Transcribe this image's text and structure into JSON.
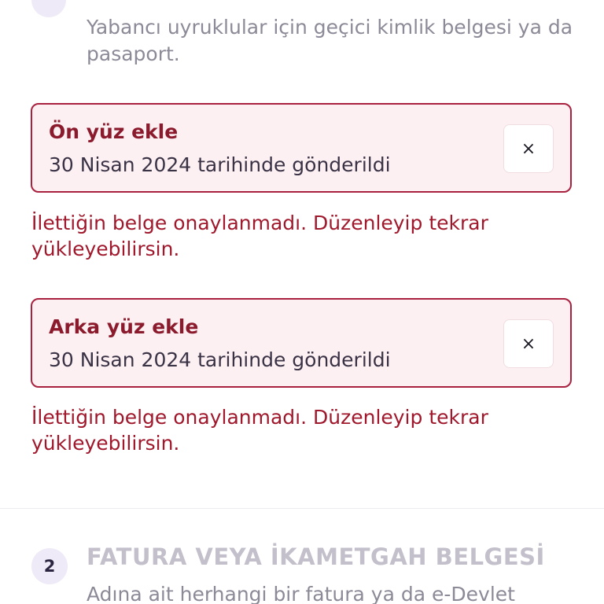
{
  "intro": {
    "text": "Yabancı uyruklular için geçici kimlik belgesi ya da pasaport."
  },
  "cards": [
    {
      "title": "Ön yüz ekle",
      "subtitle": "30 Nisan 2024 tarihinde gönderildi",
      "remove_icon": "×",
      "error": "İlettiğin belge onaylanmadı. Düzenleyip tekrar yükleyebilirsin."
    },
    {
      "title": "Arka yüz ekle",
      "subtitle": "30 Nisan 2024 tarihinde gönderildi",
      "remove_icon": "×",
      "error": "İlettiğin belge onaylanmadı. Düzenleyip tekrar yükleyebilirsin."
    }
  ],
  "section2": {
    "number": "2",
    "title": "FATURA VEYA İKAMETGAH BELGESİ",
    "description": "Adına ait herhangi bir fatura ya da e-Devlet"
  },
  "colors": {
    "error_border": "#a8223f",
    "error_bg": "#fdf0f2",
    "error_text": "#a0182c",
    "muted_text": "#8d8a98",
    "badge_bg": "#efeaf7"
  }
}
